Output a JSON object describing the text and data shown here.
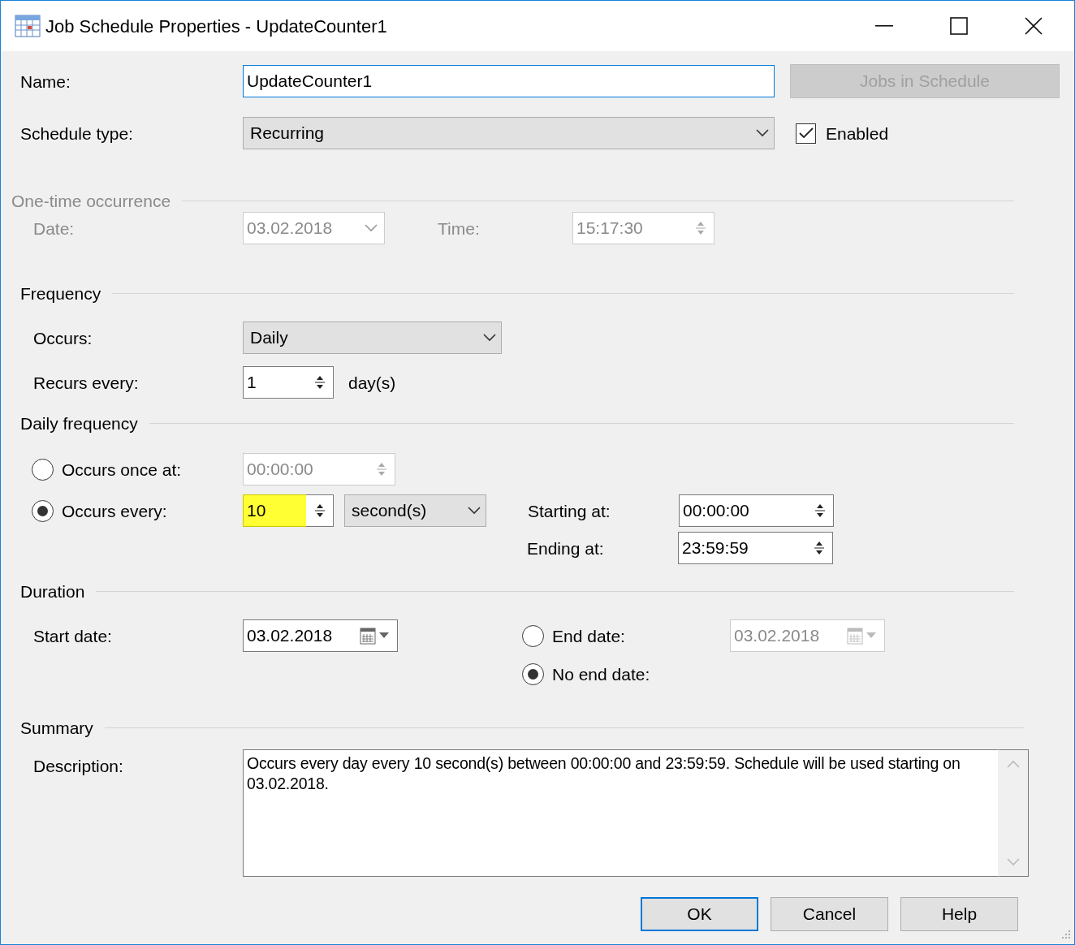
{
  "window": {
    "title": "Job Schedule Properties - UpdateCounter1"
  },
  "name": {
    "label": "Name:",
    "value": "UpdateCounter1"
  },
  "jobs_button": {
    "label": "Jobs in Schedule",
    "disabled": true
  },
  "schedule_type": {
    "label": "Schedule type:",
    "value": "Recurring"
  },
  "enabled": {
    "label": "Enabled",
    "checked": true
  },
  "one_time": {
    "title": "One-time occurrence",
    "disabled": true,
    "date_label": "Date:",
    "date": "03.02.2018",
    "time_label": "Time:",
    "time": "15:17:30"
  },
  "frequency": {
    "title": "Frequency",
    "occurs_label": "Occurs:",
    "occurs": "Daily",
    "recurs_label": "Recurs every:",
    "recurs_value": "1",
    "recurs_unit": "day(s)"
  },
  "daily_frequency": {
    "title": "Daily frequency",
    "options": [
      {
        "label": "Occurs once at:",
        "selected": false,
        "value": "00:00:00"
      },
      {
        "label": "Occurs every:",
        "selected": true,
        "value": "10",
        "highlighted": true,
        "unit": "second(s)"
      }
    ],
    "starting_label": "Starting at:",
    "starting": "00:00:00",
    "ending_label": "Ending at:",
    "ending": "23:59:59"
  },
  "duration": {
    "title": "Duration",
    "start_label": "Start date:",
    "start": "03.02.2018",
    "end_options": [
      {
        "label": "End date:",
        "selected": false,
        "date": "03.02.2018"
      },
      {
        "label": "No end date:",
        "selected": true
      }
    ]
  },
  "summary": {
    "title": "Summary",
    "description_label": "Description:",
    "description": "Occurs every day every 10 second(s) between 00:00:00 and 23:59:59. Schedule will be used starting on 03.02.2018."
  },
  "buttons": [
    {
      "label": "OK",
      "default": true
    },
    {
      "label": "Cancel",
      "default": false
    },
    {
      "label": "Help",
      "default": false
    }
  ]
}
